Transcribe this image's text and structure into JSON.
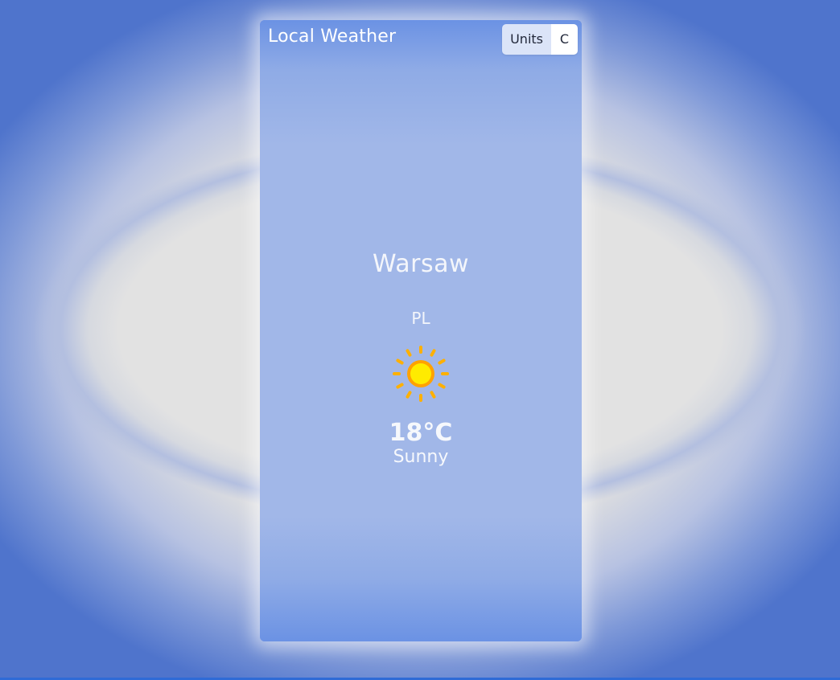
{
  "app": {
    "title": "Local Weather"
  },
  "units": {
    "label": "Units",
    "value": "C"
  },
  "location": {
    "city": "Warsaw",
    "country": "PL"
  },
  "weather": {
    "icon": "sun-icon",
    "temperature": "18°C",
    "condition": "Sunny"
  },
  "colors": {
    "sun_core": "#ffeb00",
    "sun_ring": "#ffa200",
    "sun_rays": "#ffb000",
    "card_mid": "#a1b7e8",
    "card_edge": "#6b92e4"
  }
}
